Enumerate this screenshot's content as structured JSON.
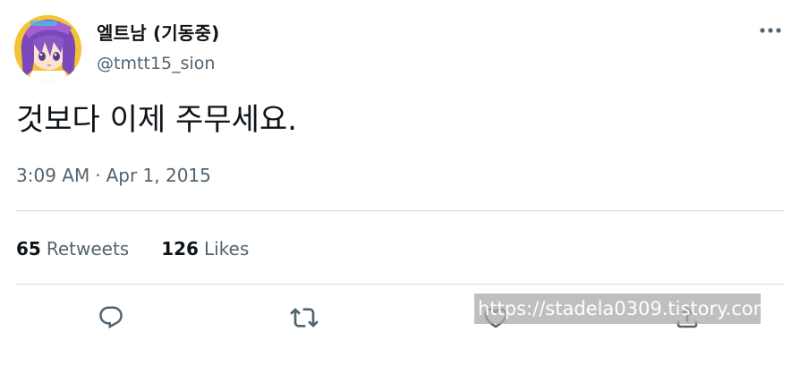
{
  "author": {
    "display_name": "엘트남 (기동중)",
    "handle": "@tmtt15_sion",
    "avatar_icon": "anime-avatar"
  },
  "tweet": {
    "text": "것보다 이제 주무세요.",
    "time": "3:09 AM",
    "separator": "·",
    "date": "Apr 1, 2015"
  },
  "stats": {
    "retweets_count": "65",
    "retweets_label": "Retweets",
    "likes_count": "126",
    "likes_label": "Likes"
  },
  "actions": [
    {
      "icon": "reply-icon"
    },
    {
      "icon": "retweet-icon"
    },
    {
      "icon": "like-icon"
    },
    {
      "icon": "share-icon"
    }
  ],
  "watermark": {
    "text": "https://stadela0309.tistory.com"
  },
  "colors": {
    "text_primary": "#0f1419",
    "text_secondary": "#536471",
    "divider": "#cfd9de",
    "icon": "#536471"
  }
}
